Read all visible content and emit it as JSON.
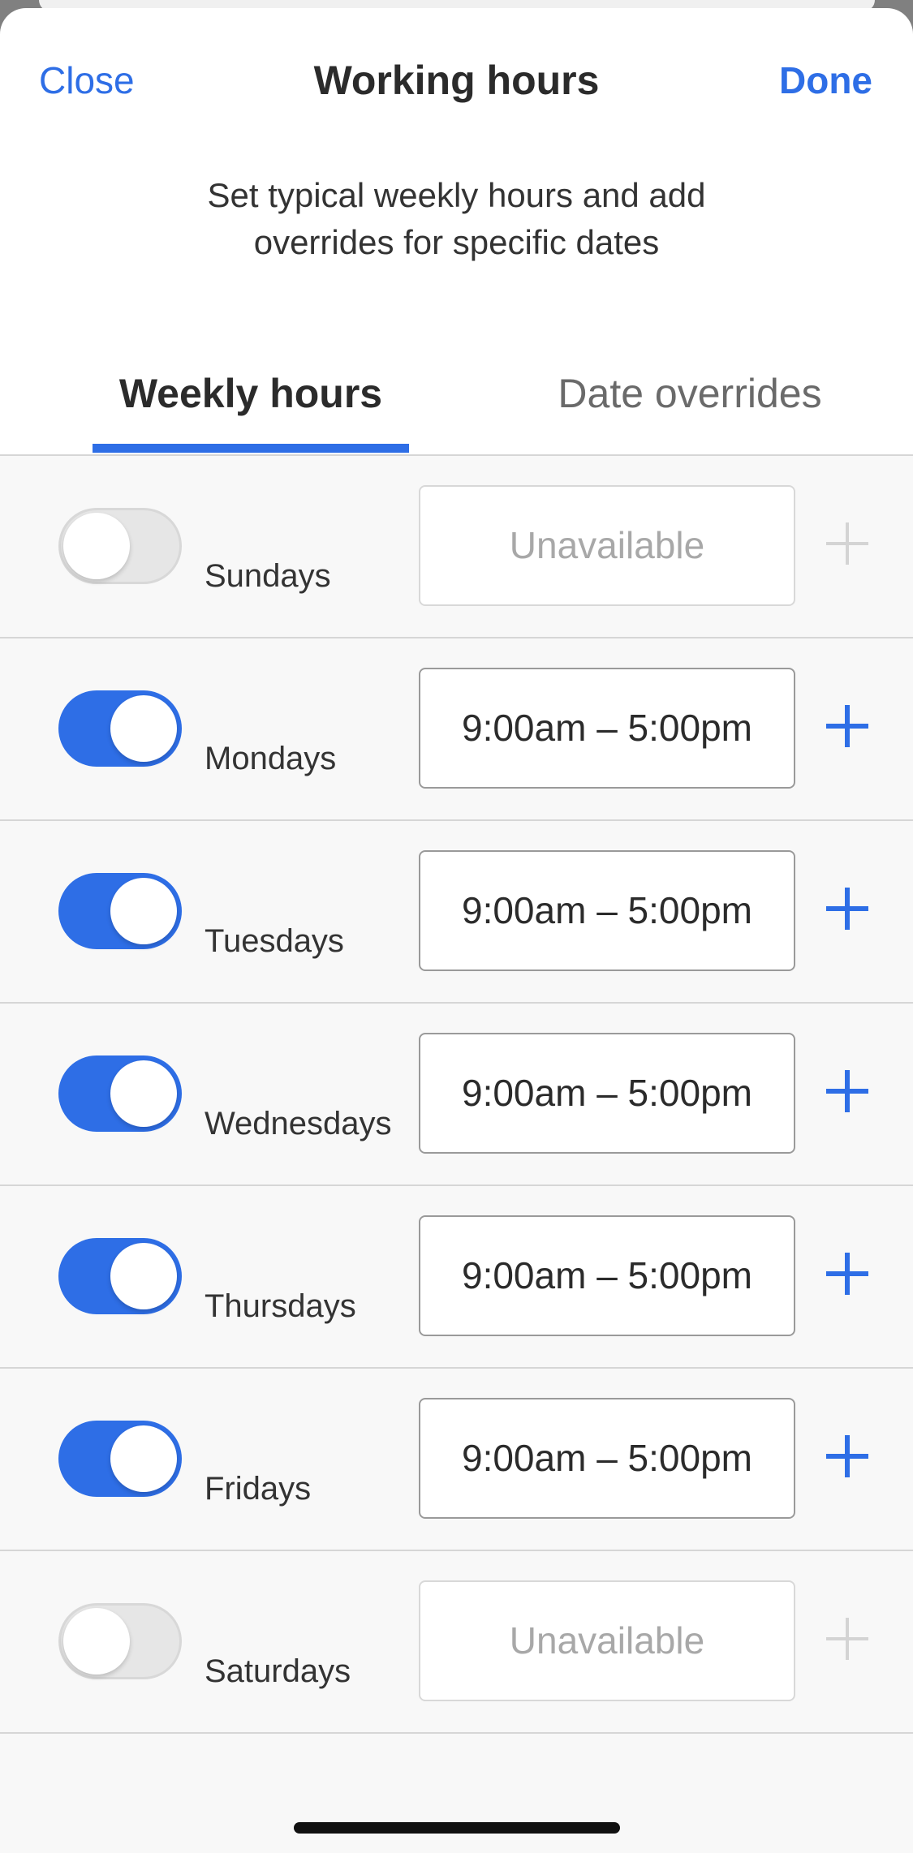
{
  "header": {
    "close_label": "Close",
    "title": "Working hours",
    "done_label": "Done"
  },
  "subtitle_lines": [
    "Set typical weekly hours and add",
    "overrides for specific dates"
  ],
  "tabs": [
    {
      "label": "Weekly hours",
      "active": true
    },
    {
      "label": "Date overrides",
      "active": false
    }
  ],
  "days": [
    {
      "name": "Sundays",
      "enabled": false,
      "hours": "Unavailable"
    },
    {
      "name": "Mondays",
      "enabled": true,
      "hours": "9:00am – 5:00pm"
    },
    {
      "name": "Tuesdays",
      "enabled": true,
      "hours": "9:00am – 5:00pm"
    },
    {
      "name": "Wednesdays",
      "enabled": true,
      "hours": "9:00am – 5:00pm"
    },
    {
      "name": "Thursdays",
      "enabled": true,
      "hours": "9:00am – 5:00pm"
    },
    {
      "name": "Fridays",
      "enabled": true,
      "hours": "9:00am – 5:00pm"
    },
    {
      "name": "Saturdays",
      "enabled": false,
      "hours": "Unavailable"
    }
  ],
  "colors": {
    "accent": "#2e6ee6",
    "toggle_off": "#e6e6e6",
    "text_primary": "#2b2b2b",
    "text_muted": "#a8a8a8"
  },
  "icons": {
    "add": "plus-icon"
  }
}
